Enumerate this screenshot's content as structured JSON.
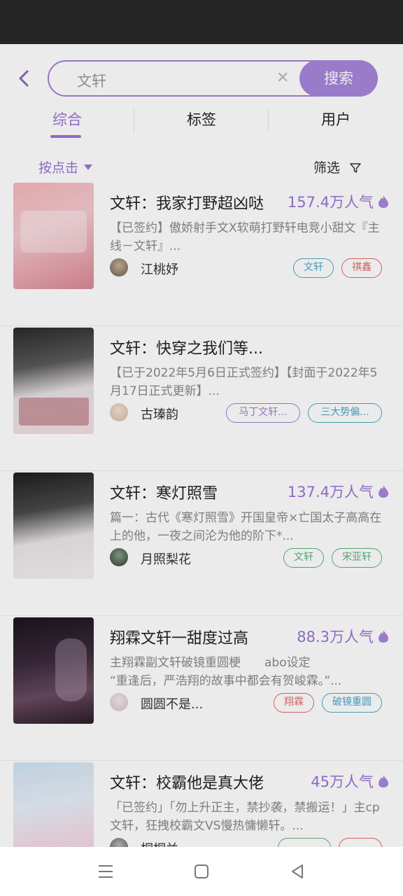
{
  "search": {
    "value": "文轩",
    "button": "搜索"
  },
  "tabs": [
    "综合",
    "标签",
    "用户"
  ],
  "sort_label": "按点击",
  "filter_label": "筛选",
  "colors": {
    "accent": "#9b73d4",
    "tag_blue": "#4ba9c8",
    "tag_red": "#e06a6a",
    "tag_purple": "#a37fd6",
    "tag_green": "#5fb07a"
  },
  "items": [
    {
      "title": "文轩：我家打野超凶哒",
      "popularity": "157.4万人气",
      "desc": "【已签约】傲娇射手文X软萌打野轩电竞小甜文『主线－文轩』...",
      "author": "江桃妤",
      "tags": [
        {
          "label": "文轩",
          "color": "#4ba9c8"
        },
        {
          "label": "祺鑫",
          "color": "#e06a6a"
        }
      ]
    },
    {
      "title": "文轩：快穿之我们等...",
      "popularity": "",
      "desc": "【已于2022年5月6日正式签约】【封面于2022年5月17日正式更新】...",
      "author": "古瑧韵",
      "tags": [
        {
          "label": "马丁文轩...",
          "color": "#a37fd6"
        },
        {
          "label": "三大势偏...",
          "color": "#4ba9c8"
        }
      ]
    },
    {
      "title": "文轩：寒灯照雪",
      "popularity": "137.4万人气",
      "desc": "篇一：古代《寒灯照雪》开国皇帝×亡国太子高高在上的他，一夜之间沦为他的阶下*...",
      "author": "月照梨花",
      "tags": [
        {
          "label": "文轩",
          "color": "#5fb07a"
        },
        {
          "label": "宋亚轩",
          "color": "#5fb07a"
        }
      ]
    },
    {
      "title": "翔霖文轩一甜度过高",
      "popularity": "88.3万人气",
      "desc": "主翔霖副文轩破镜重圆梗　　abo设定\n“重逢后，严浩翔的故事中都会有贺峻霖。”...",
      "author": "圆圆不是...",
      "tags": [
        {
          "label": "翔霖",
          "color": "#e06a6a"
        },
        {
          "label": "破镜重圆",
          "color": "#4ba9c8"
        }
      ]
    },
    {
      "title": "文轩：校霸他是真大佬",
      "popularity": "45万人气",
      "desc": "「已签约」「勿上升正主，禁抄袭，禁搬运！」主cp文轩，狂拽校霸文VS慢热慵懒轩。...",
      "author": "桐桐兰",
      "tags": [
        {
          "label": "",
          "color": "#5fb07a"
        },
        {
          "label": "",
          "color": "#e06a6a"
        }
      ]
    }
  ]
}
